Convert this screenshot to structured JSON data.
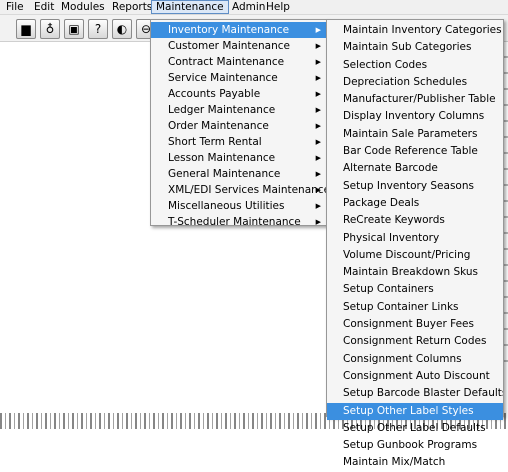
{
  "menubar": {
    "items": [
      "File",
      "Edit",
      "Modules",
      "Reports",
      "Maintenance",
      "Admin",
      "Help"
    ]
  },
  "toolbar": {
    "icons": [
      "document-icon",
      "bottle-icon",
      "image-icon",
      "help-icon",
      "palette-icon",
      "stop-icon"
    ]
  },
  "maintenance_menu": {
    "items": [
      "Inventory Maintenance",
      "Customer Maintenance",
      "Contract Maintenance",
      "Service Maintenance",
      "Accounts Payable",
      "Ledger Maintenance",
      "Order Maintenance",
      "Short Term Rental",
      "Lesson Maintenance",
      "General Maintenance",
      "XML/EDI Services Maintenance",
      "Miscellaneous Utilities",
      "T-Scheduler Maintenance"
    ],
    "arrow": "▶"
  },
  "inventory_submenu": {
    "items": [
      "Maintain Inventory Categories",
      "Maintain Sub Categories",
      "Selection Codes",
      "Depreciation Schedules",
      "Manufacturer/Publisher Table",
      "Display Inventory Columns",
      "Maintain Sale Parameters",
      "Bar Code Reference Table",
      "Alternate Barcode",
      "Setup Inventory Seasons",
      "Package Deals",
      "ReCreate Keywords",
      "Physical Inventory",
      "Volume Discount/Pricing",
      "Maintain Breakdown Skus",
      "Setup Containers",
      "Setup Container Links",
      "Consignment Buyer Fees",
      "Consignment Return Codes",
      "Consignment Columns",
      "Consignment Auto Discount",
      "Setup Barcode Blaster Defaults",
      "Setup Other Label Styles",
      "Setup Other Label Defaults",
      "Setup Gunbook Programs",
      "Maintain Mix/Match"
    ]
  },
  "colors": {
    "highlight": "#3b8fe0",
    "menu_bg": "#f5f5f5"
  }
}
